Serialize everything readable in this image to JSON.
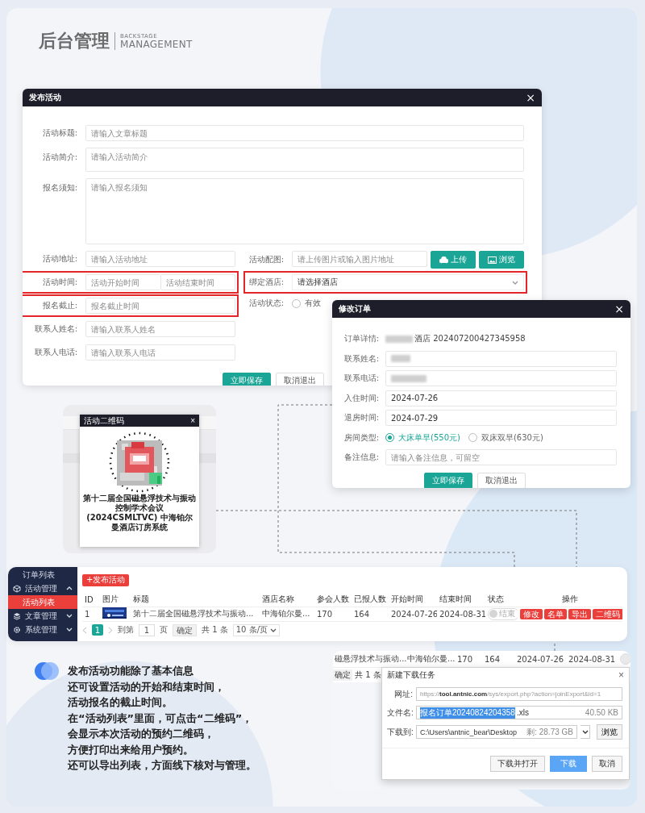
{
  "header": {
    "title": "后台管理",
    "subtitle_top": "BACKSTAGE",
    "subtitle_bottom": "MANAGEMENT"
  },
  "publish_dialog": {
    "title": "发布活动",
    "close": "×",
    "fields": [
      {
        "kind": "input",
        "label": "活动标题:",
        "placeholder": "请输入文章标题"
      },
      {
        "kind": "textarea",
        "label": "活动简介:",
        "placeholder": "请输入活动简介"
      },
      {
        "kind": "textarea",
        "label": "报名须知:",
        "placeholder": "请输入报名须知"
      }
    ],
    "rows": [
      {
        "left": {
          "kind": "input",
          "label": "活动地址:",
          "placeholder": "请输入活动地址",
          "highlighted": false
        },
        "right": {
          "kind": "upload",
          "label": "活动配图:",
          "placeholder": "请上传图片或输入图片地址",
          "highlighted": false,
          "buttons": [
            {
              "kind": "upload",
              "label": "上传"
            },
            {
              "kind": "browse",
              "label": "浏览"
            }
          ]
        }
      },
      {
        "left": {
          "kind": "range",
          "label": "活动时间:",
          "placeholders": [
            "活动开始时间",
            "活动结束时间"
          ],
          "highlighted": true
        },
        "right": {
          "kind": "select",
          "label": "绑定酒店:",
          "value": "请选择酒店",
          "highlighted": true
        }
      },
      {
        "left": {
          "kind": "input",
          "label": "报名截止:",
          "placeholder": "报名截止时间",
          "highlighted": true
        },
        "right": {
          "kind": "radio",
          "label": "活动状态:",
          "highlighted": false,
          "options": [
            {
              "label": "有效",
              "selected": false
            }
          ]
        }
      },
      {
        "left": {
          "kind": "input",
          "label": "联系人姓名:",
          "placeholder": "请输入联系人姓名",
          "highlighted": false
        }
      },
      {
        "left": {
          "kind": "input",
          "label": "联系人电话:",
          "placeholder": "请输入联系人电话",
          "highlighted": false
        }
      }
    ],
    "buttons": [
      {
        "kind": "primary",
        "label": "立即保存"
      },
      {
        "kind": "default",
        "label": "取消退出"
      }
    ]
  },
  "order_dialog": {
    "title": "修改订单",
    "close": "×",
    "fields": [
      {
        "kind": "text",
        "label": "订单详情:",
        "redacted": true,
        "value": "酒店 202407200427345958"
      },
      {
        "kind": "input",
        "label": "联系姓名:",
        "redacted": true
      },
      {
        "kind": "input",
        "label": "联系电话:",
        "redacted": true
      },
      {
        "kind": "input",
        "label": "入住时间:",
        "redacted": false,
        "value": "2024-07-26"
      },
      {
        "kind": "input",
        "label": "退房时间:",
        "redacted": false,
        "value": "2024-07-29"
      },
      {
        "kind": "radio",
        "label": "房间类型:",
        "options": [
          {
            "label": "大床单早(550元)",
            "selected": true
          },
          {
            "label": "双床双早(630元)",
            "selected": false
          }
        ]
      },
      {
        "kind": "input",
        "label": "备注信息:",
        "redacted": false,
        "placeholder": "请输入备注信息，可留空"
      }
    ],
    "buttons": [
      {
        "kind": "primary",
        "label": "立即保存"
      },
      {
        "kind": "default",
        "label": "取消退出"
      }
    ]
  },
  "qr_card": {
    "dialog_title": "活动二维码",
    "close": "×",
    "caption": [
      "第十二届全国磁悬浮技术与振动控制学术会议",
      "(2024CSMLTVC) 中海铂尔曼酒店订房系统"
    ]
  },
  "list_panel": {
    "sidebar": [
      {
        "kind": "sub",
        "label": "订单列表",
        "selected": false
      },
      {
        "kind": "group",
        "label": "活动管理",
        "selected": false,
        "expanded": true
      },
      {
        "kind": "sub",
        "label": "活动列表",
        "selected": true
      },
      {
        "kind": "group",
        "label": "文章管理",
        "selected": false,
        "expanded": false
      },
      {
        "kind": "group",
        "label": "系统管理",
        "selected": false,
        "expanded": false
      }
    ],
    "add_button": "+发布活动",
    "table": {
      "columns": [
        "ID",
        "图片",
        "标题",
        "酒店名称",
        "参会人数",
        "已报人数",
        "开始时间",
        "结束时间",
        "状态",
        "操作"
      ],
      "rows": [
        {
          "id": "1",
          "title": "第十二届全国磁悬浮技术与振动...",
          "hotel": "中海铂尔曼...",
          "attendees": "170",
          "registered": "164",
          "start": "2024-07-26",
          "end": "2024-08-31",
          "status": {
            "label": "结束",
            "on": false
          },
          "actions": [
            "修改",
            "名单",
            "导出",
            "二维码"
          ]
        }
      ]
    },
    "pagination": {
      "pages": [
        {
          "label": "1",
          "selected": true
        }
      ],
      "goto_label": "到第",
      "goto_value": "1",
      "page_unit": "页",
      "confirm": "确定",
      "total": "共 1 条",
      "page_size": "10 条/页"
    }
  },
  "download_panel": {
    "background_row": [
      "磁悬浮技术与振动...",
      "中海铂尔曼...",
      "170",
      "164",
      "2024-07-26",
      "2024-08-31"
    ],
    "background_footer": [
      "确定",
      "共 1 条"
    ],
    "dialog": {
      "title": "新建下载任务",
      "close": "×",
      "url_label": "网址:",
      "url": "https://**tool.antnic.com**/sys/export.php?action=joinExport&id=1",
      "filename_label": "文件名:",
      "filename_selected": "报名订单20240824204358",
      "filename_rest": ".xls",
      "file_size": "40.50 KB",
      "path_label": "下载到:",
      "path": "C:\\Users\\antnic_bear\\Desktop",
      "free_space": "剩: 28.73 GB",
      "browse": "浏览",
      "buttons": [
        {
          "kind": "default",
          "label": "下载并打开"
        },
        {
          "kind": "primary",
          "label": "下载"
        },
        {
          "kind": "default",
          "label": "取消"
        }
      ]
    }
  },
  "note": {
    "lines": [
      "发布活动功能除了基本信息",
      "还可设置活动的开始和结束时间，",
      "活动报名的截止时间。",
      "在“活动列表”里面，可点击“二维码”，",
      "会显示本次活动的预约二维码，",
      "方便打印出来给用户预约。",
      "还可以导出列表，方面线下核对与管理。"
    ]
  }
}
